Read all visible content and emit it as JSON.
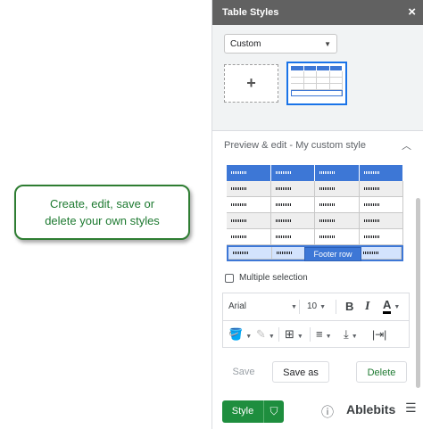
{
  "callout": {
    "line1": "Create, edit, save or",
    "line2": "delete your own styles"
  },
  "panel": {
    "title": "Table Styles",
    "close_glyph": "×",
    "style_select": {
      "value": "Custom"
    },
    "add_style_glyph": "+",
    "preview_heading": "Preview & edit - My custom style",
    "footer_row_label": "Footer row",
    "multiple_selection_label": "Multiple selection",
    "toolbar": {
      "font": "Arial",
      "size": "10",
      "bold": "B",
      "italic": "I",
      "text_color": "A"
    },
    "buttons": {
      "save": "Save",
      "save_as": "Save as",
      "delete": "Delete"
    },
    "style_button": "Style",
    "brand": "Ablebits"
  },
  "colors": {
    "header_accent": "#3d77d6",
    "green": "#1e8e3e",
    "panel_header": "#616161"
  }
}
